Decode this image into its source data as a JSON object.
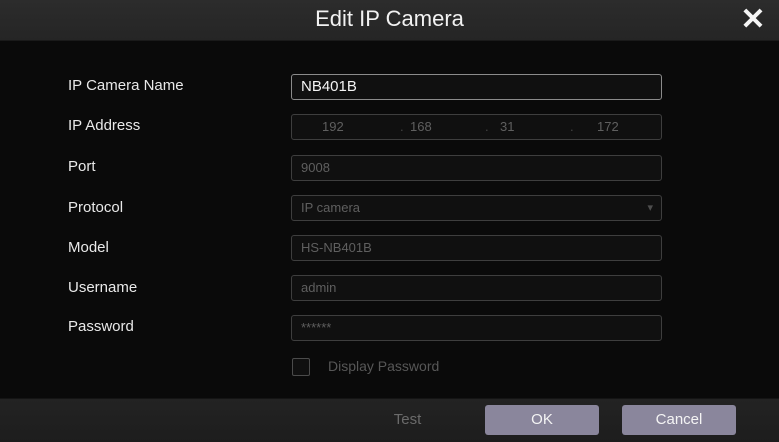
{
  "dialog": {
    "title": "Edit IP Camera"
  },
  "form": {
    "name_label": "IP Camera Name",
    "name_value": "NB401B",
    "ip_label": "IP Address",
    "ip_octets": [
      "192",
      "168",
      "31",
      "172"
    ],
    "ip_separator": ".",
    "port_label": "Port",
    "port_value": "9008",
    "protocol_label": "Protocol",
    "protocol_value": "IP camera",
    "model_label": "Model",
    "model_value": "HS-NB401B",
    "username_label": "Username",
    "username_value": "admin",
    "password_label": "Password",
    "password_value": "******",
    "display_password_label": "Display Password"
  },
  "footer": {
    "test_label": "Test",
    "ok_label": "OK",
    "cancel_label": "Cancel"
  },
  "icons": {
    "close": "close-icon",
    "dropdown": "chevron-down-icon"
  },
  "colors": {
    "button_bg": "#8a869c",
    "background": "#0a0a0a"
  }
}
